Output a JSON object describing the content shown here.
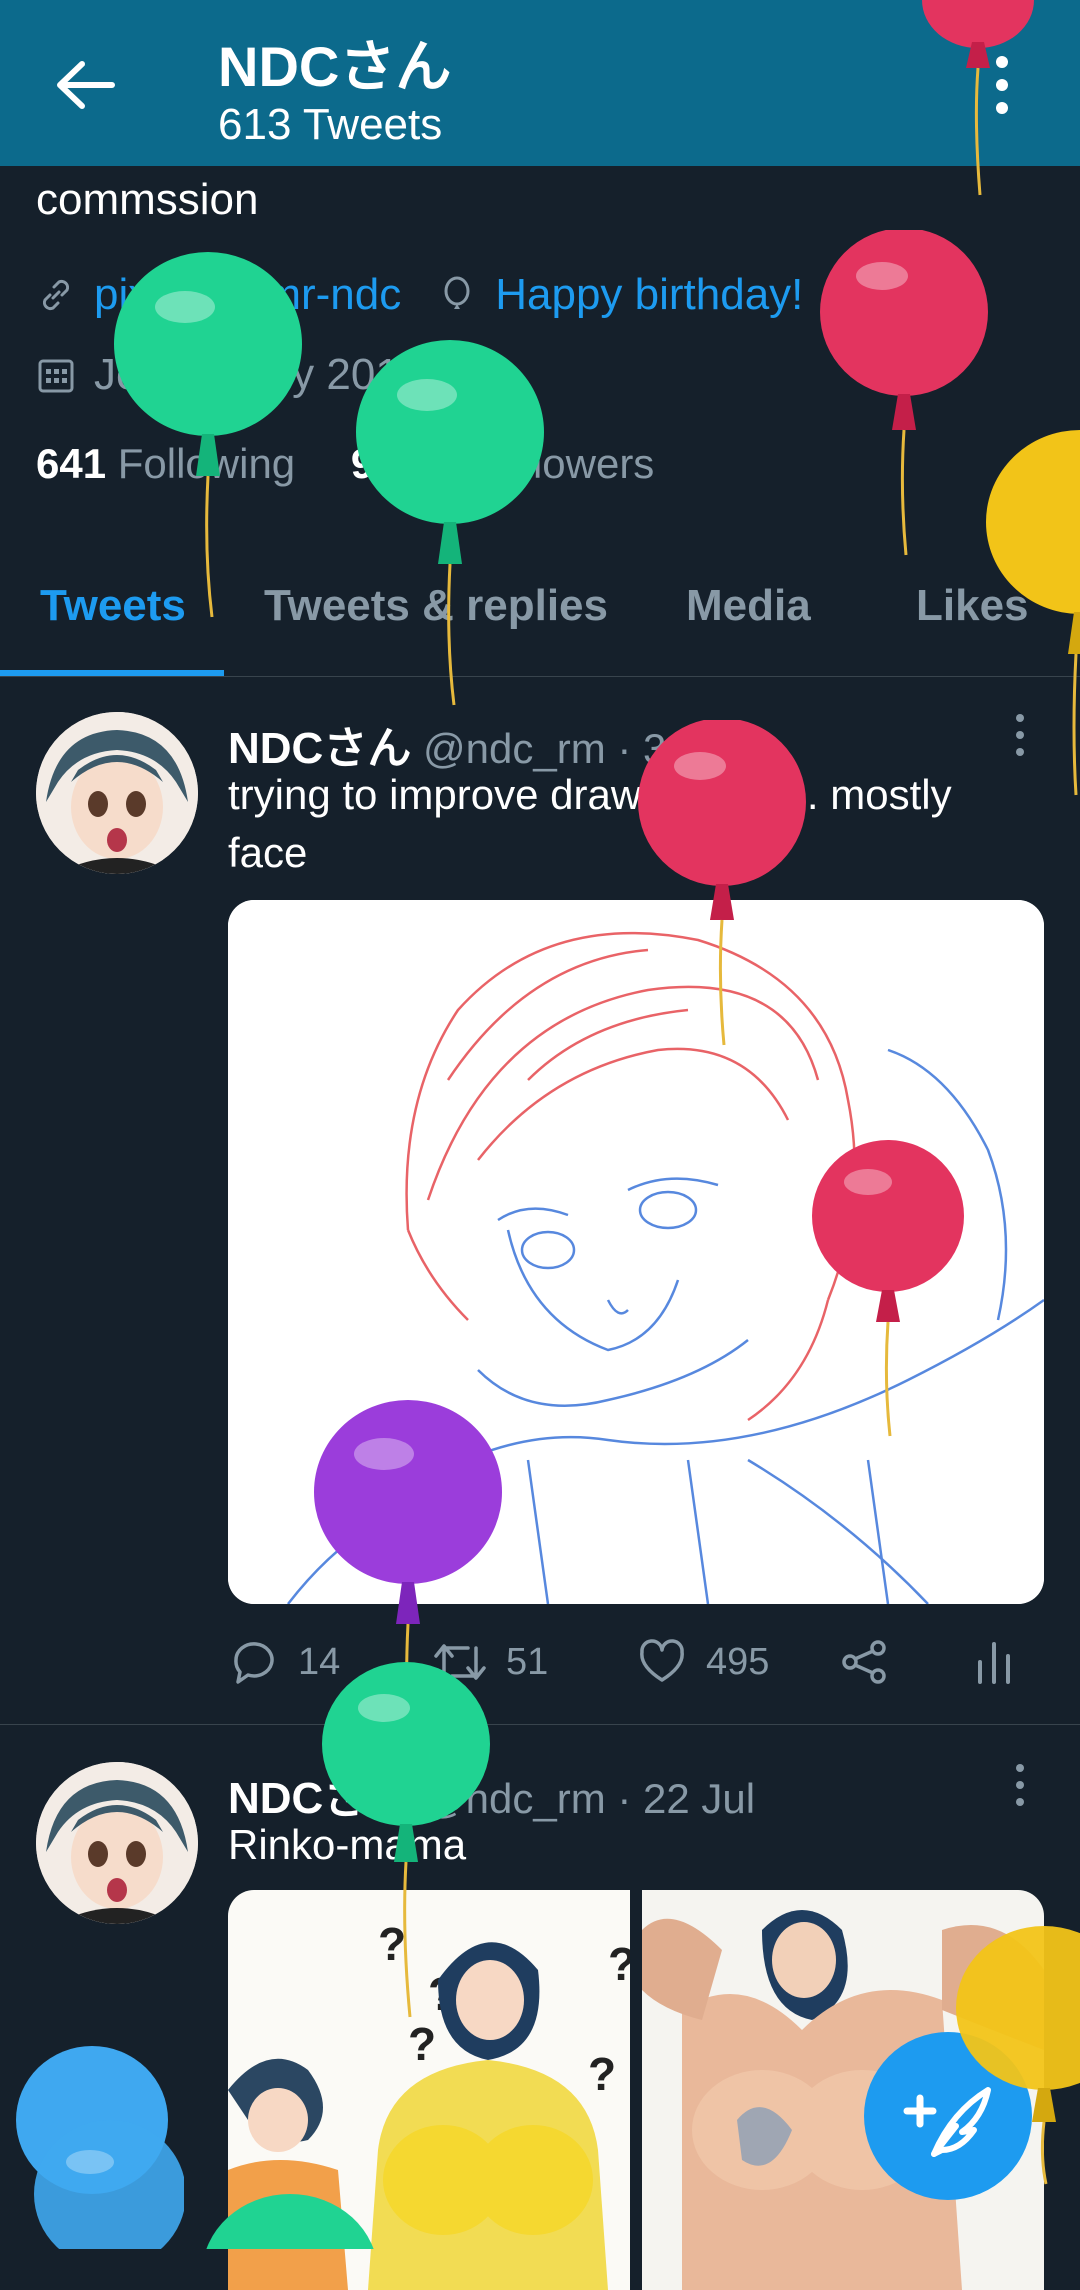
{
  "header": {
    "title": "NDCさん",
    "subtitle": "613 Tweets"
  },
  "profile": {
    "bio": "commssion",
    "link": "pixiv.me/mr-ndc",
    "birthday": "Happy birthday!",
    "joined": "Joined July 2016",
    "following_count": "641",
    "following_label": "Following",
    "followers_count": "92.8K",
    "followers_label": "Followers"
  },
  "tabs": [
    "Tweets",
    "Tweets & replies",
    "Media",
    "Likes"
  ],
  "tweets": [
    {
      "name": "NDCさん",
      "handle": "@ndc_rm · 3d",
      "text": "trying to improve drawing style.. mostly face",
      "replies": "14",
      "retweets": "51",
      "likes": "495"
    },
    {
      "name": "NDCさん",
      "handle": "@ndc_rm · 22 Jul",
      "text": "Rinko-mama"
    }
  ],
  "colors": {
    "header_bg": "#0c6a8c",
    "page_bg": "#15202b",
    "accent": "#1d9bf0",
    "balloon_green": "#20d392",
    "balloon_red": "#e3345f",
    "balloon_yellow": "#f2c418",
    "balloon_purple": "#9b3ddb",
    "balloon_blue": "#3fa8f0"
  },
  "icons": [
    "back-arrow-icon",
    "more-vertical-icon",
    "link-icon",
    "balloon-icon",
    "calendar-icon",
    "reply-icon",
    "retweet-icon",
    "like-icon",
    "share-icon",
    "analytics-icon",
    "compose-icon"
  ]
}
